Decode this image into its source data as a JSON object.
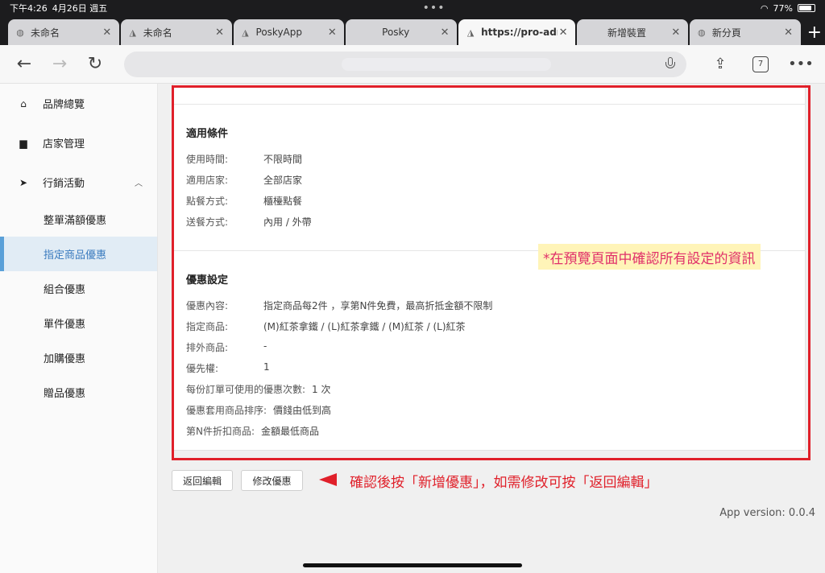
{
  "status_bar": {
    "time": "下午4:26",
    "date": "4月26日 週五",
    "battery": "77%"
  },
  "tabs": [
    {
      "label": "未命名",
      "favicon": "globe-icon",
      "active": false
    },
    {
      "label": "未命名",
      "favicon": "app-logo-icon",
      "active": false
    },
    {
      "label": "PoskyApp",
      "favicon": "app-logo-icon",
      "active": false
    },
    {
      "label": "Posky",
      "favicon": "",
      "active": false
    },
    {
      "label": "https://pro-adm",
      "favicon": "app-logo-icon",
      "active": true
    },
    {
      "label": "新增裝置",
      "favicon": "",
      "active": false
    },
    {
      "label": "新分頁",
      "favicon": "globe-icon",
      "active": false
    }
  ],
  "toolbar": {
    "tab_count": "7"
  },
  "sidebar": {
    "items": [
      {
        "label": "品牌總覽",
        "icon": "home-icon"
      },
      {
        "label": "店家管理",
        "icon": "store-icon"
      },
      {
        "label": "行銷活動",
        "icon": "send-icon"
      }
    ],
    "subitems": [
      {
        "label": "整單滿額優惠",
        "active": false
      },
      {
        "label": "指定商品優惠",
        "active": true
      },
      {
        "label": "組合優惠",
        "active": false
      },
      {
        "label": "單件優惠",
        "active": false
      },
      {
        "label": "加購優惠",
        "active": false
      },
      {
        "label": "贈品優惠",
        "active": false
      }
    ]
  },
  "conditions": {
    "title": "適用條件",
    "rows": [
      {
        "k": "使用時間:",
        "v": "不限時間"
      },
      {
        "k": "適用店家:",
        "v": "全部店家"
      },
      {
        "k": "點餐方式:",
        "v": "櫃檯點餐"
      },
      {
        "k": "送餐方式:",
        "v": "內用 / 外帶"
      }
    ]
  },
  "discount": {
    "title": "優惠設定",
    "rows": [
      {
        "k": "優惠內容:",
        "v": "指定商品每2件 ，享第N件免費，最高折抵金額不限制"
      },
      {
        "k": "指定商品:",
        "v": "(M)紅茶拿鐵 / (L)紅茶拿鐵 / (M)紅茶 / (L)紅茶"
      },
      {
        "k": "排外商品:",
        "v": "-"
      },
      {
        "k": "優先權:",
        "v": "1"
      },
      {
        "k": "每份訂單可使用的優惠次數:",
        "v": "1 次"
      },
      {
        "k": "優惠套用商品排序:",
        "v": "價錢由低到高"
      },
      {
        "k": "第N件折扣商品:",
        "v": "金額最低商品"
      }
    ]
  },
  "annotation": {
    "note": "*在預覽頁面中確認所有設定的資訊",
    "instruction": "確認後按「新增優惠」，如需修改可按「返回編輯」"
  },
  "buttons": {
    "back_edit": "返回編輯",
    "modify": "修改優惠"
  },
  "app_version": "App version: 0.0.4"
}
